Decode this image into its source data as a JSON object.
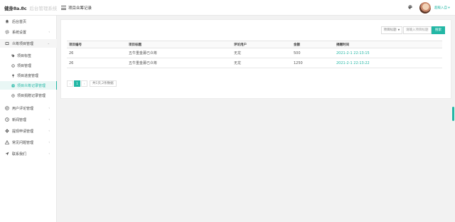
{
  "app": {
    "logo_text": "健身8a.8c",
    "subtitle": "后台管理系统",
    "breadcrumb": "项目众筹记录"
  },
  "user": {
    "name": "超級入自 ▾"
  },
  "colors": {
    "accent": "#23b7a5"
  },
  "sidebar": {
    "items": [
      {
        "label": "后台首页",
        "icon": "home-icon",
        "arrow": ""
      },
      {
        "label": "系统设置",
        "icon": "gear-icon",
        "arrow": "‹"
      },
      {
        "label": "众筹项目管理",
        "icon": "folder-icon",
        "arrow": "‹"
      },
      {
        "label": "用户评论管理",
        "icon": "comment-icon",
        "arrow": "‹"
      },
      {
        "label": "新闻管理",
        "icon": "news-icon",
        "arrow": "‹"
      },
      {
        "label": "提现申请管理",
        "icon": "settings-icon",
        "arrow": "‹"
      },
      {
        "label": "常见问题管理",
        "icon": "warning-icon",
        "arrow": "‹"
      },
      {
        "label": "联系我们",
        "icon": "contact-icon",
        "arrow": "‹"
      }
    ],
    "sub_items": [
      {
        "label": "项目标签",
        "icon": "tag-icon"
      },
      {
        "label": "项目管理",
        "icon": "circle-icon"
      },
      {
        "label": "项目进度管理",
        "icon": "pin-icon"
      },
      {
        "label": "项目众筹记录管理",
        "icon": "record-icon"
      },
      {
        "label": "项目捐赠记录管理",
        "icon": "donate-icon"
      }
    ]
  },
  "filters": {
    "select_label": "项目标题",
    "search_placeholder": "请输入项目标题",
    "search_button": "搜索"
  },
  "table": {
    "headers": [
      "项目编号",
      "项目标题",
      "评论用户",
      "金额",
      "捐赠时间"
    ],
    "rows": [
      [
        "26",
        "五牛重金募已众筹",
        "无龙",
        "500",
        "2021-2-1 22:13:15"
      ],
      [
        "26",
        "五牛重金募已众筹",
        "无龙",
        "1250",
        "2021-2-1 22:13:22"
      ]
    ]
  },
  "pagination": {
    "prev": "‹",
    "current": "1",
    "next": "›",
    "summary": "共1页,2条数据"
  }
}
